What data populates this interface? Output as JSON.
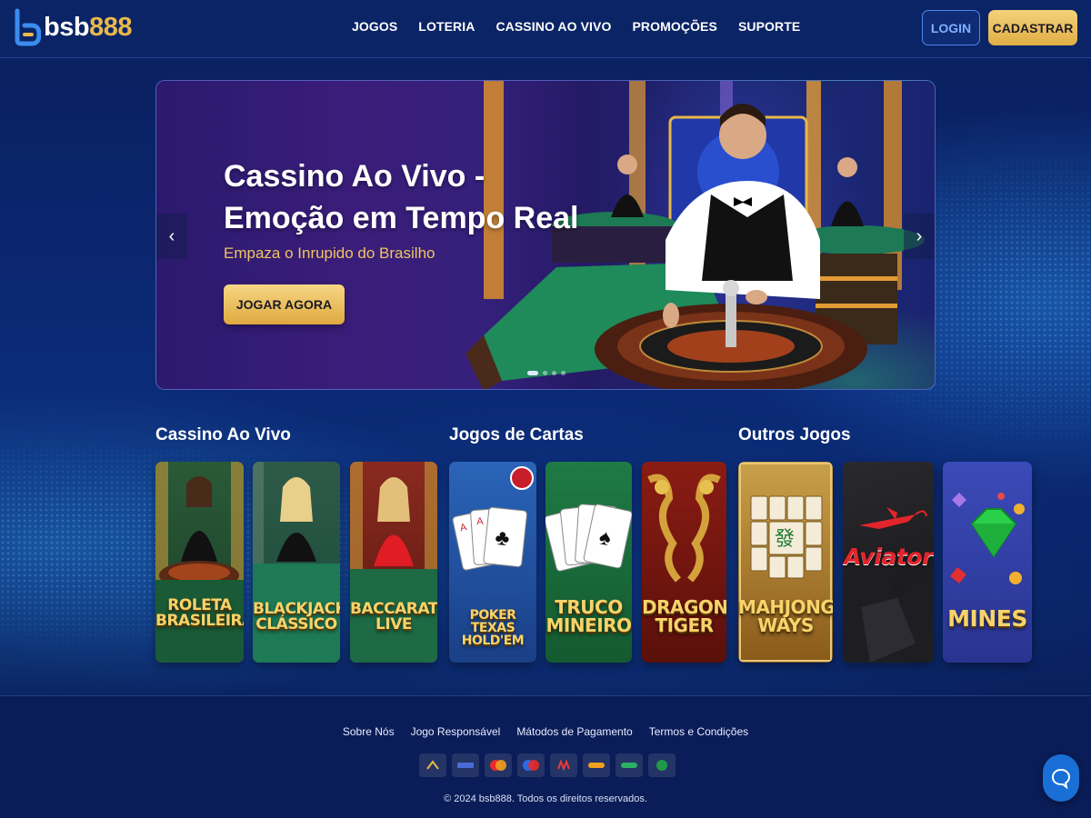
{
  "header": {
    "logo": {
      "part1": "bsb",
      "part2": "888"
    },
    "nav": [
      "JOGOS",
      "LOTERIA",
      "CASSINO AO VIVO",
      "PROMOÇÕES",
      "SUPORTE"
    ],
    "login_label": "LOGIN",
    "register_label": "CADASTRAR"
  },
  "hero": {
    "title": "Cassino Ao Vivo - Emoção em Tempo Real",
    "subtitle": "Empaza o Inrupido do Brasilho",
    "cta_label": "JOGAR AGORA",
    "slides_total": 4,
    "active_slide": 1
  },
  "sections": [
    {
      "title": "Cassino Ao Vivo"
    },
    {
      "title": "Jogos de Cartas"
    },
    {
      "title": "Outros Jogos"
    }
  ],
  "games": [
    {
      "name": "ROLETA BRASILEIRA",
      "lines": [
        "ROLETA",
        "BRASILEIRA"
      ],
      "section": "Cassino Ao Vivo"
    },
    {
      "name": "BLACKJACK CLÁSSICO",
      "lines": [
        "BLACKJACK",
        "CLÁSSICO"
      ],
      "section": "Cassino Ao Vivo"
    },
    {
      "name": "BACCARAT LIVE",
      "lines": [
        "BACCARAT",
        "LIVE"
      ],
      "section": "Cassino Ao Vivo"
    },
    {
      "name": "POKER TEXAS HOLD'EM",
      "lines": [
        "POKER TEXAS",
        "HOLD'EM"
      ],
      "section": "Jogos de Cartas"
    },
    {
      "name": "TRUCO MINEIRO",
      "lines": [
        "TRUCO",
        "MINEIRO"
      ],
      "section": "Jogos de Cartas"
    },
    {
      "name": "DRAGON TIGER",
      "lines": [
        "DRAGON",
        "TIGER"
      ],
      "section": "Jogos de Cartas"
    },
    {
      "name": "MAHJONG WAYS",
      "lines": [
        "MAHJONG",
        "WAYS"
      ],
      "section": "Outros Jogos"
    },
    {
      "name": "Aviator",
      "lines": [
        "Aviator"
      ],
      "section": "Outros Jogos"
    },
    {
      "name": "MINES",
      "lines": [
        "MINES"
      ],
      "section": "Outros Jogos"
    }
  ],
  "footer": {
    "links": [
      "Sobre Nós",
      "Jogo Responsável",
      "Mátodos de Pagamento",
      "Termos e Condições"
    ],
    "payment_methods": [
      "pix-icon",
      "visa-icon",
      "mastercard-icon",
      "maestro-icon",
      "boleto-icon",
      "pay-icon",
      "wallet-icon",
      "sk-icon"
    ],
    "copyright": "© 2024 bsb888. Todos os direitos reservados."
  },
  "colors": {
    "accent_gold": "#e8b84a",
    "brand_blue": "#0b2466",
    "login_border": "#4f86e6"
  }
}
